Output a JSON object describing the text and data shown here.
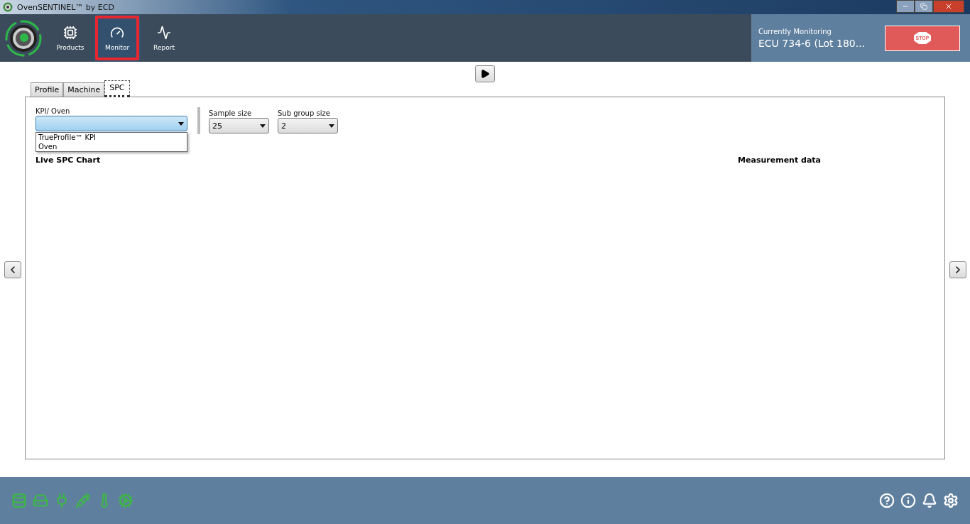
{
  "window": {
    "title": "OvenSENTINEL™ by ECD"
  },
  "nav": [
    {
      "label": "Products",
      "selected": false
    },
    {
      "label": "Monitor",
      "selected": true
    },
    {
      "label": "Report",
      "selected": false
    }
  ],
  "monitoring": {
    "caption": "Currently Monitoring",
    "value": "ECU 734-6 (Lot 180...",
    "stop_label": "STOP"
  },
  "tabs": [
    {
      "label": "Profile",
      "selected": false
    },
    {
      "label": "Machine",
      "selected": false
    },
    {
      "label": "SPC",
      "selected": true
    }
  ],
  "kpi": {
    "label": "KPI/ Oven",
    "expanded": true,
    "options": [
      "TrueProfile™ KPI",
      "Oven"
    ]
  },
  "sample_size": {
    "label": "Sample size",
    "value": "25"
  },
  "sub_group_size": {
    "label": "Sub group size",
    "value": "2"
  },
  "live_chart_title": "Live SPC Chart",
  "measurement_title": "Measurement data"
}
